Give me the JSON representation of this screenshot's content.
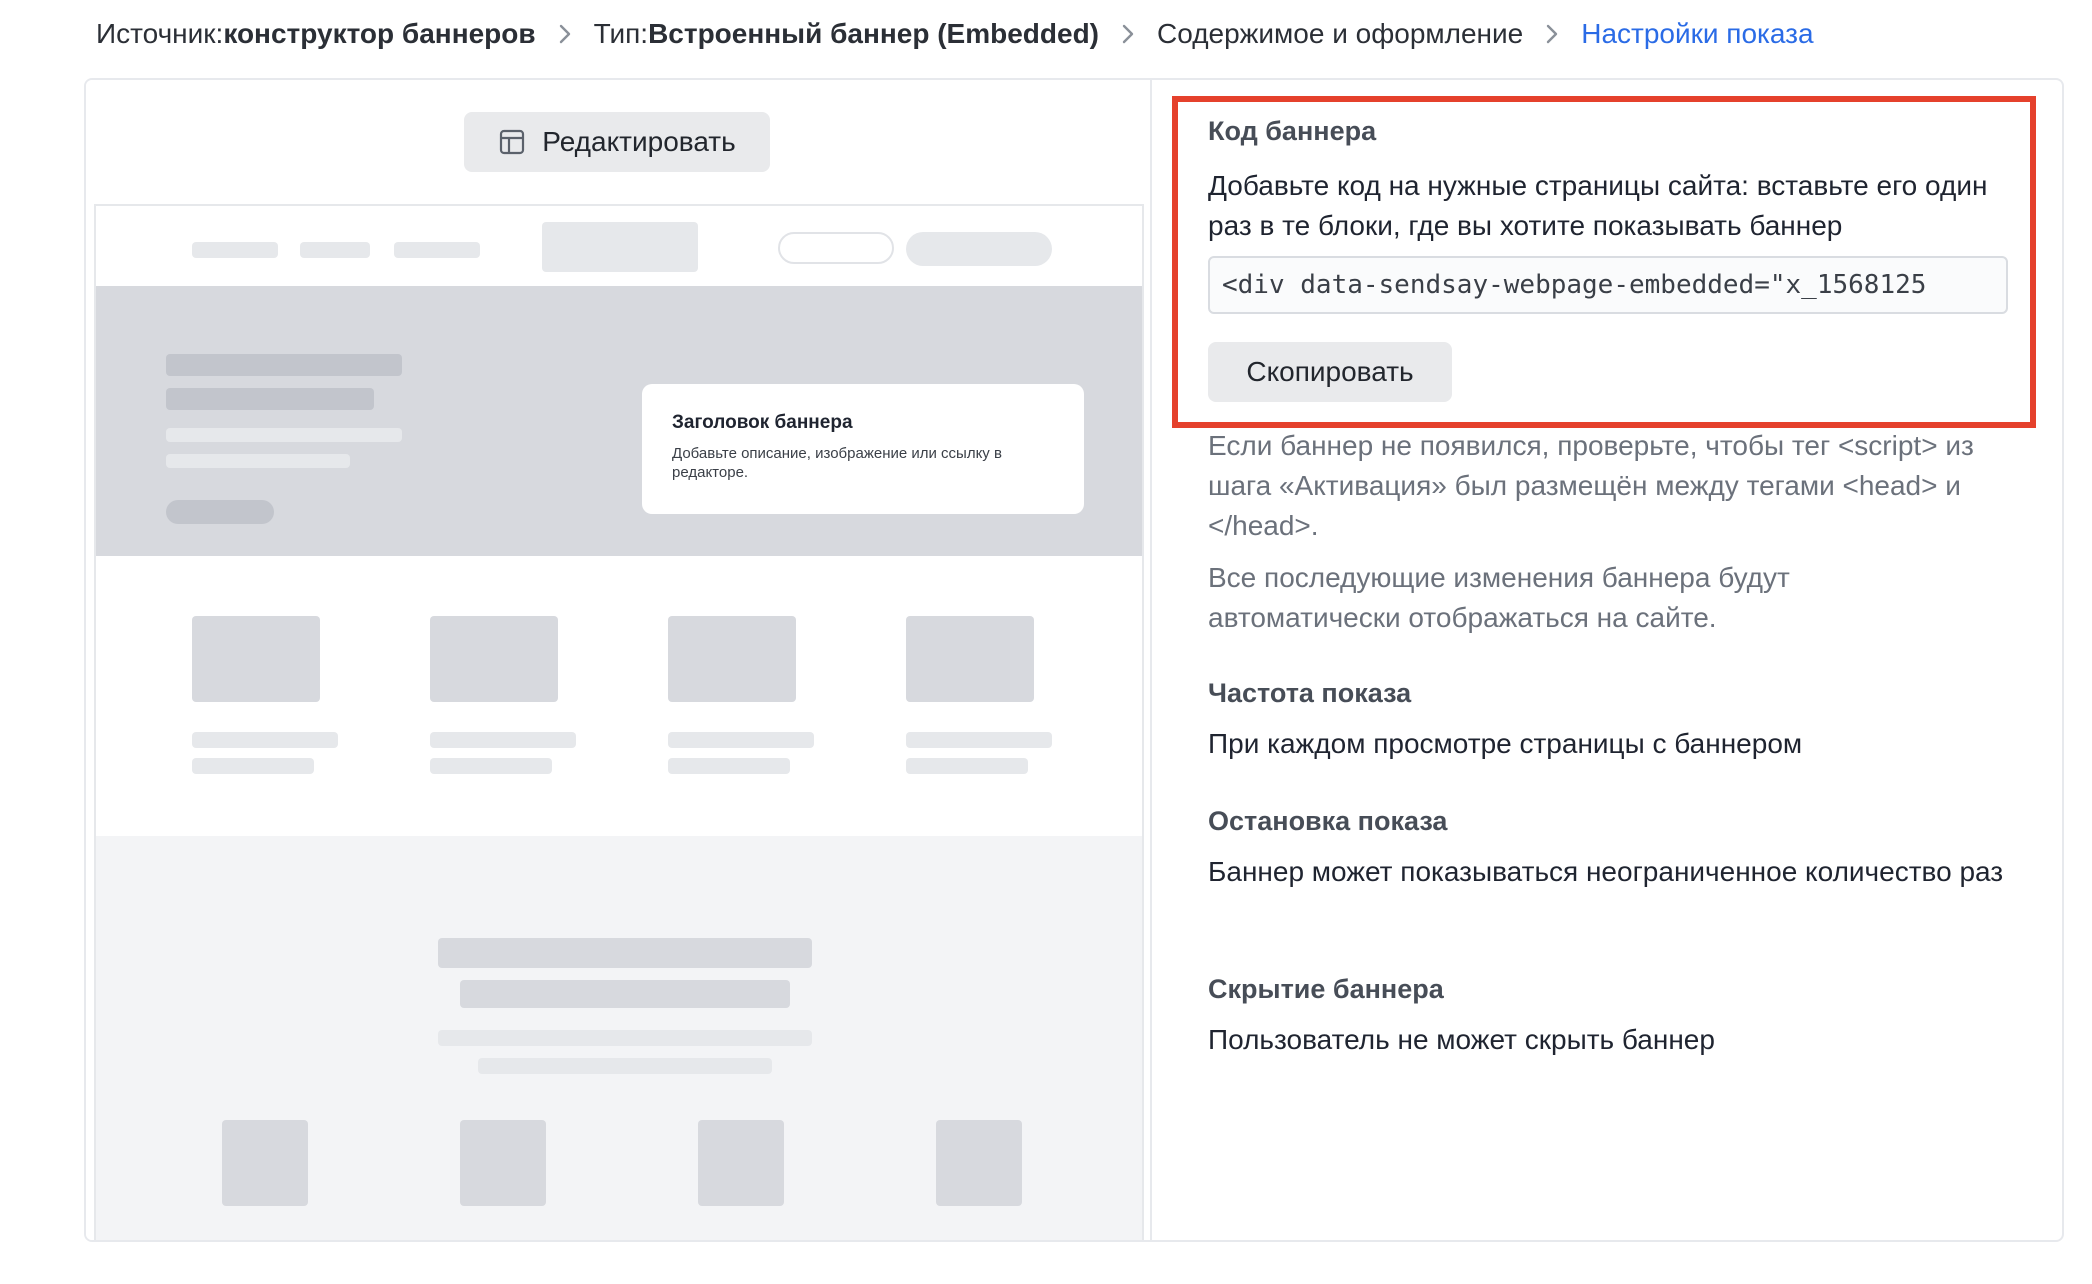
{
  "breadcrumb": {
    "items": [
      {
        "prefix": "Источник: ",
        "value": "конструктор баннеров"
      },
      {
        "prefix": "Тип: ",
        "value": "Встроенный баннер (Embedded)"
      },
      {
        "prefix": "",
        "value": "Содержимое и оформление"
      },
      {
        "prefix": "",
        "value": "Настройки показа"
      }
    ],
    "separator_icon": "chevron-right-icon",
    "active_color": "#2a6be6"
  },
  "preview": {
    "edit_button_label": "Редактировать",
    "edit_icon": "layout-icon",
    "banner_title": "Заголовок баннера",
    "banner_description": "Добавьте описание, изображение или ссылку в редакторе."
  },
  "settings": {
    "code": {
      "title": "Код баннера",
      "description": "Добавьте код на нужные страницы сайта: вставьте его один раз в те блоки, где вы хотите показывать баннер",
      "value": "<div data-sendsay-webpage-embedded=\"x_1568125",
      "copy_label": "Скопировать",
      "note": "Если баннер не появился, проверьте, чтобы тег <script> из шага «Активация» был размещён между тегами <head> и </head>.",
      "auto_update_note": "Все последующие изменения баннера будут автоматически отображаться на сайте.",
      "highlight_color": "#e5412c"
    },
    "frequency": {
      "title": "Частота показа",
      "value": "При каждом просмотре страницы с баннером"
    },
    "stop": {
      "title": "Остановка показа",
      "value": "Баннер может показываться неограниченное количество раз"
    },
    "hide": {
      "title": "Скрытие баннера",
      "value": "Пользователь не может скрыть баннер"
    }
  }
}
